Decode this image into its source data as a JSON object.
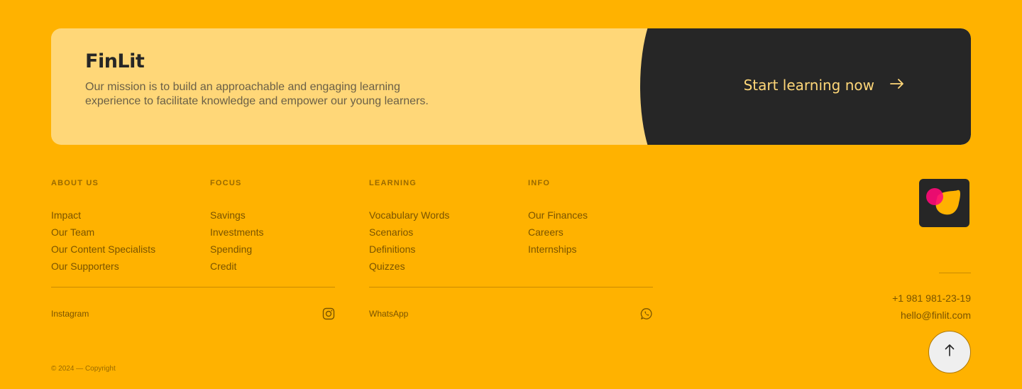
{
  "banner": {
    "brand": "FinLit",
    "mission": "Our mission is to build an approachable and engaging learning experience to facilitate knowledge and empower our young learners.",
    "cta_label": "Start learning now",
    "cta_icon": "arrow-right-icon"
  },
  "columns": [
    {
      "heading": "ABOUT US",
      "items": [
        "Impact",
        "Our Team",
        "Our Content Specialists",
        "Our Supporters"
      ]
    },
    {
      "heading": "FOCUS",
      "items": [
        "Savings",
        "Investments",
        "Spending",
        "Credit"
      ]
    },
    {
      "heading": "LEARNING",
      "items": [
        "Vocabulary Words",
        "Scenarios",
        "Definitions",
        "Quizzes"
      ]
    },
    {
      "heading": "INFO",
      "items": [
        "Our Finances",
        "Careers",
        "Internships"
      ]
    }
  ],
  "social": {
    "instagram_label": "Instagram",
    "whatsapp_label": "WhatsApp"
  },
  "contact": {
    "phone": "+1 981 981-23-19",
    "email": "hello@finlit.com"
  },
  "copyright": "© 2024 — Copyright",
  "colors": {
    "background": "#FFB200",
    "banner_light": "#FFD778",
    "banner_dark": "#262626",
    "logo_pink": "#FF0A78",
    "logo_yellow": "#FFB200"
  }
}
